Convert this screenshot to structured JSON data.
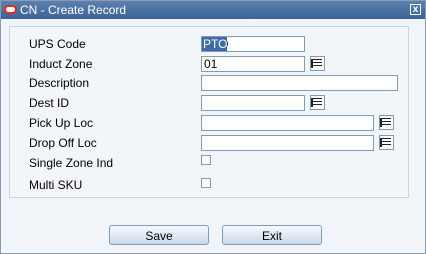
{
  "window": {
    "title": "CN - Create Record",
    "close_label": "x"
  },
  "form": {
    "ups_code": {
      "label": "UPS Code",
      "value": "PTO"
    },
    "induct_zone": {
      "label": "Induct Zone",
      "value": "01"
    },
    "description": {
      "label": "Description",
      "value": ""
    },
    "dest_id": {
      "label": "Dest ID",
      "value": ""
    },
    "pick_up_loc": {
      "label": "Pick Up Loc",
      "value": ""
    },
    "drop_off_loc": {
      "label": "Drop Off Loc",
      "value": ""
    },
    "single_zone_ind": {
      "label": "Single Zone Ind",
      "checked": false
    },
    "multi_sku": {
      "label": "Multi SKU",
      "checked": false
    }
  },
  "buttons": {
    "save": "Save",
    "exit": "Exit"
  },
  "icons": {
    "app": "oracle-icon",
    "lov": "list-of-values-icon",
    "close": "close-icon"
  }
}
